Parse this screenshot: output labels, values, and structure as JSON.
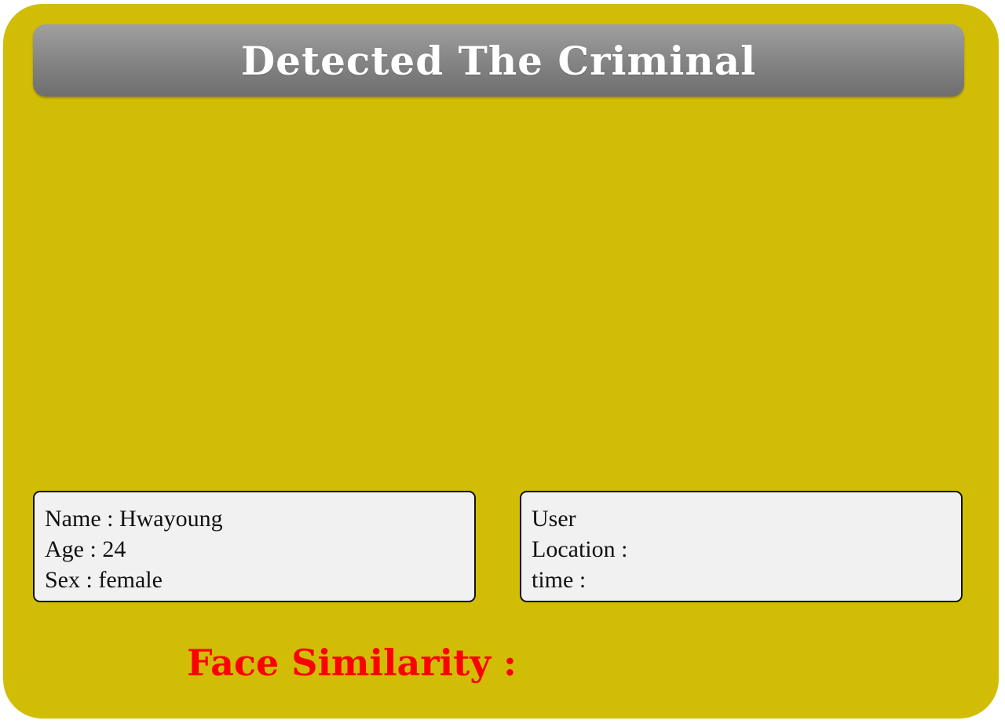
{
  "colors": {
    "panel_background": "#d1bd05",
    "title_bar": "#858585",
    "title_text": "#ffffff",
    "info_box_background": "#f1f1f1",
    "similarity_text": "#ff0000"
  },
  "header": {
    "title": "Detected The Criminal"
  },
  "criminal_info": {
    "name_line": "Name : Hwayoung",
    "age_line": "Age : 24",
    "sex_line": "Sex : female"
  },
  "user_info": {
    "user_line": "User",
    "location_line": "Location :",
    "time_line": "time :"
  },
  "similarity": {
    "label": "Face Similarity :"
  }
}
